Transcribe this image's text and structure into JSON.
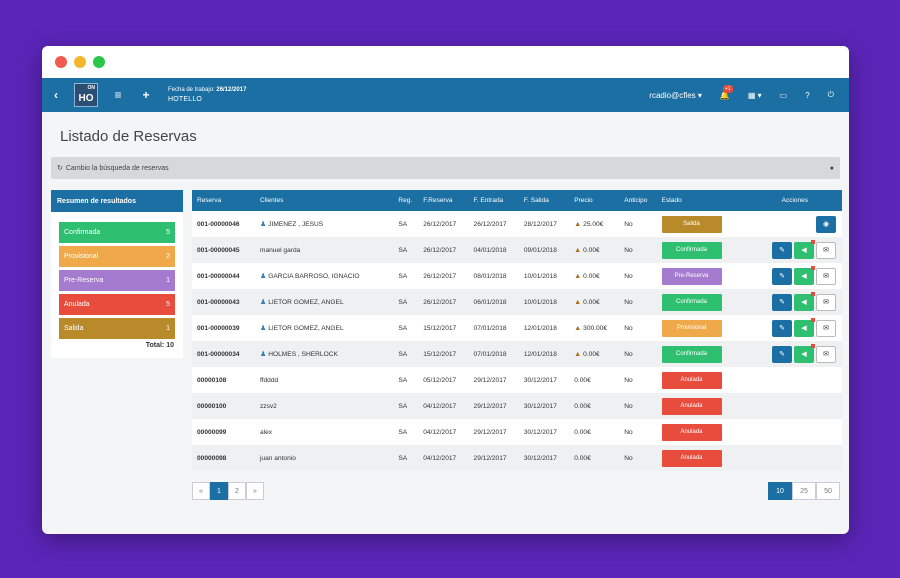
{
  "topbar": {
    "fecha_label": "Fecha de trabajo:",
    "fecha_value": "26/12/2017",
    "hotel": "HOTELLO",
    "logo_text": "HO",
    "logo_mini": "ON",
    "user": "rcadio@cfles ▾",
    "notif_count": "+1"
  },
  "page": {
    "title": "Listado de Reservas",
    "search_toggle": "Cambio la búsqueda de reservas"
  },
  "summary": {
    "title": "Resumen de resultados",
    "items": [
      {
        "label": "Confirmada",
        "count": "5",
        "color": "#2fbf71"
      },
      {
        "label": "Provisional",
        "count": "2",
        "color": "#f0a94a"
      },
      {
        "label": "Pre-Reserva",
        "count": "1",
        "color": "#a57bd0"
      },
      {
        "label": "Anulada",
        "count": "5",
        "color": "#e74c3c"
      },
      {
        "label": "Salida",
        "count": "1",
        "color": "#b88a2a"
      }
    ],
    "total": "Total: 10"
  },
  "table": {
    "headers": [
      "Reserva",
      "Clientes",
      "Reg.",
      "F.Reserva",
      "F. Entrada",
      "F. Salida",
      "Precio",
      "Anticipo",
      "Estado",
      "Acciones"
    ],
    "rows": [
      {
        "code": "001-00000046",
        "client": "JIMENEZ , JESUS",
        "person": true,
        "reg": "SA",
        "freserva": "26/12/2017",
        "fentrada": "26/12/2017",
        "fsalida": "28/12/2017",
        "precio": "25.00€",
        "warn": true,
        "anticipo": "No",
        "estado": "Salida",
        "color": "#b88a2a",
        "actions": "view"
      },
      {
        "code": "001-00000045",
        "client": "manuel garda",
        "person": false,
        "reg": "SA",
        "freserva": "26/12/2017",
        "fentrada": "04/01/2018",
        "fsalida": "09/01/2018",
        "precio": "0.00€",
        "warn": true,
        "anticipo": "No",
        "estado": "Confirmada",
        "color": "#2fbf71",
        "actions": "full"
      },
      {
        "code": "001-00000044",
        "client": "GARCIA BARROSO, IGNACIO",
        "person": true,
        "reg": "SA",
        "freserva": "26/12/2017",
        "fentrada": "08/01/2018",
        "fsalida": "10/01/2018",
        "precio": "0.00€",
        "warn": true,
        "anticipo": "No",
        "estado": "Pre-Reserva",
        "color": "#a57bd0",
        "actions": "full"
      },
      {
        "code": "001-00000043",
        "client": "LIETOR GOMEZ, ANGEL",
        "person": true,
        "reg": "SA",
        "freserva": "26/12/2017",
        "fentrada": "06/01/2018",
        "fsalida": "10/01/2018",
        "precio": "0.00€",
        "warn": true,
        "anticipo": "No",
        "estado": "Confirmada",
        "color": "#2fbf71",
        "actions": "full"
      },
      {
        "code": "001-00000039",
        "client": "LIETOR GOMEZ, ANGEL",
        "person": true,
        "reg": "SA",
        "freserva": "15/12/2017",
        "fentrada": "07/01/2018",
        "fsalida": "12/01/2018",
        "precio": "300.00€",
        "warn": true,
        "anticipo": "No",
        "estado": "Provisional",
        "color": "#f0a94a",
        "actions": "full"
      },
      {
        "code": "001-00000034",
        "client": "HOLMES , SHERLOCK",
        "person": true,
        "reg": "SA",
        "freserva": "15/12/2017",
        "fentrada": "07/01/2018",
        "fsalida": "12/01/2018",
        "precio": "0.00€",
        "warn": true,
        "anticipo": "No",
        "estado": "Confirmada",
        "color": "#2fbf71",
        "actions": "full"
      },
      {
        "code": "00000108",
        "client": "ffdddd",
        "person": false,
        "reg": "SA",
        "freserva": "05/12/2017",
        "fentrada": "29/12/2017",
        "fsalida": "30/12/2017",
        "precio": "0.00€",
        "warn": false,
        "anticipo": "No",
        "estado": "Anulada",
        "color": "#e74c3c",
        "actions": "none"
      },
      {
        "code": "00000100",
        "client": "zzsv2",
        "person": false,
        "reg": "SA",
        "freserva": "04/12/2017",
        "fentrada": "29/12/2017",
        "fsalida": "30/12/2017",
        "precio": "0.00€",
        "warn": false,
        "anticipo": "No",
        "estado": "Anulada",
        "color": "#e74c3c",
        "actions": "none"
      },
      {
        "code": "00000099",
        "client": "alex",
        "person": false,
        "reg": "SA",
        "freserva": "04/12/2017",
        "fentrada": "29/12/2017",
        "fsalida": "30/12/2017",
        "precio": "0.00€",
        "warn": false,
        "anticipo": "No",
        "estado": "Anulada",
        "color": "#e74c3c",
        "actions": "none"
      },
      {
        "code": "00000098",
        "client": "juan antonio",
        "person": false,
        "reg": "SA",
        "freserva": "04/12/2017",
        "fentrada": "29/12/2017",
        "fsalida": "30/12/2017",
        "precio": "0.00€",
        "warn": false,
        "anticipo": "No",
        "estado": "Anulada",
        "color": "#e74c3c",
        "actions": "none"
      }
    ]
  },
  "pagination": {
    "prev": "«",
    "pages": [
      "1",
      "2"
    ],
    "next": "»",
    "sizes": [
      "10",
      "25",
      "50"
    ]
  },
  "colors": {
    "primary": "#1b6fa3",
    "background": "#5b25b8"
  }
}
